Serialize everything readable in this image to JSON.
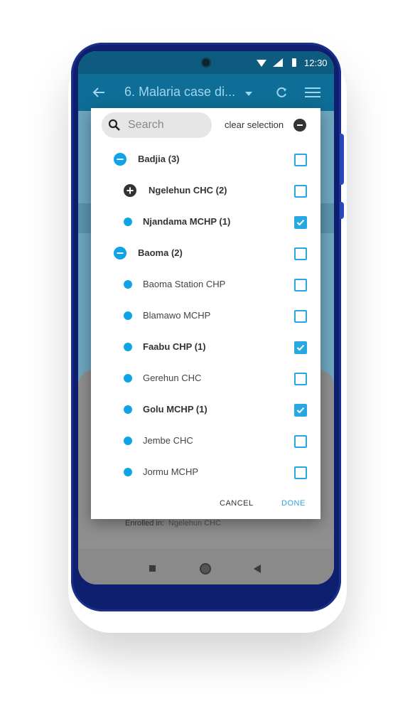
{
  "status": {
    "time": "12:30"
  },
  "appbar": {
    "title": "6. Malaria case di..."
  },
  "background": {
    "enrolled_label": "Enrolled in:",
    "enrolled_value": "Ngelehun CHC"
  },
  "dialog": {
    "search_placeholder": "Search",
    "clear_label": "clear selection",
    "rows": [
      {
        "label": "Badjia (3)",
        "bold": true,
        "marker": "minus",
        "checked": false
      },
      {
        "label": "Ngelehun CHC (2)",
        "bold": true,
        "marker": "plus",
        "checked": false
      },
      {
        "label": "Njandama MCHP (1)",
        "bold": true,
        "marker": "dot",
        "checked": true
      },
      {
        "label": "Baoma (2)",
        "bold": true,
        "marker": "minus",
        "checked": false
      },
      {
        "label": "Baoma Station CHP",
        "bold": false,
        "marker": "dot",
        "checked": false
      },
      {
        "label": "Blamawo MCHP",
        "bold": false,
        "marker": "dot",
        "checked": false
      },
      {
        "label": "Faabu CHP (1)",
        "bold": true,
        "marker": "dot",
        "checked": true
      },
      {
        "label": "Gerehun CHC",
        "bold": false,
        "marker": "dot",
        "checked": false
      },
      {
        "label": "Golu MCHP (1)",
        "bold": true,
        "marker": "dot",
        "checked": true
      },
      {
        "label": "Jembe CHC",
        "bold": false,
        "marker": "dot",
        "checked": false
      },
      {
        "label": "Jormu MCHP",
        "bold": false,
        "marker": "dot",
        "checked": false
      }
    ],
    "cancel_label": "CANCEL",
    "done_label": "DONE"
  },
  "colors": {
    "accent": "#28a8e0",
    "dot": "#0fa4e8",
    "appbar": "#0f6e97",
    "phone": "#0d1f6e"
  }
}
